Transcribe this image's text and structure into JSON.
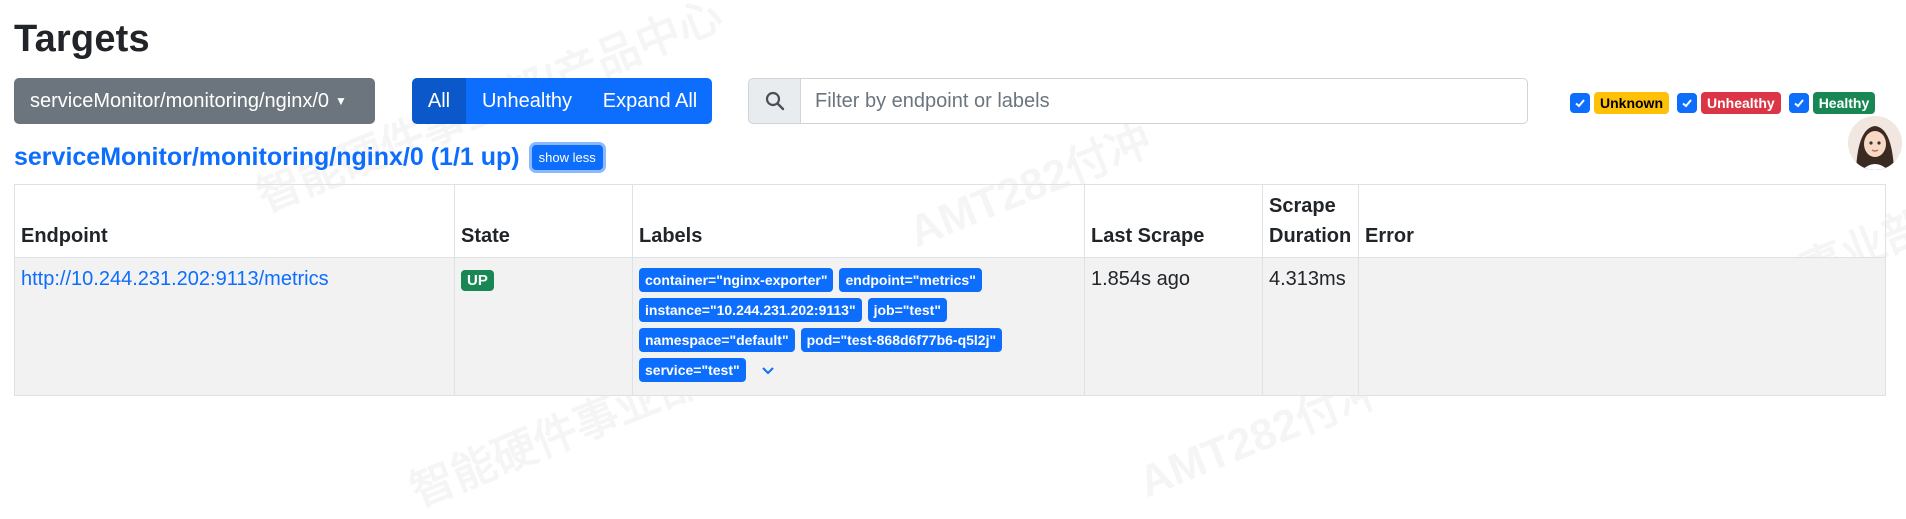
{
  "page": {
    "title": "Targets"
  },
  "controls": {
    "scrape_pool_selected": "serviceMonitor/monitoring/nginx/0",
    "filter_buttons": [
      "All",
      "Unhealthy",
      "Expand All"
    ],
    "active_filter": "All",
    "search": {
      "placeholder": "Filter by endpoint or labels",
      "value": ""
    },
    "health_filters": [
      {
        "label": "Unknown",
        "checked": true,
        "color": "#ffc107"
      },
      {
        "label": "Unhealthy",
        "checked": true,
        "color": "#dc3545"
      },
      {
        "label": "Healthy",
        "checked": true,
        "color": "#198754"
      }
    ]
  },
  "pool": {
    "title": "serviceMonitor/monitoring/nginx/0 (1/1 up)",
    "toggle_label": "show less",
    "columns": [
      "Endpoint",
      "State",
      "Labels",
      "Last Scrape",
      "Scrape Duration",
      "Error"
    ],
    "rows": [
      {
        "endpoint": "http://10.244.231.202:9113/metrics",
        "state": "UP",
        "labels": [
          "container=\"nginx-exporter\"",
          "endpoint=\"metrics\"",
          "instance=\"10.244.231.202:9113\"",
          "job=\"test\"",
          "namespace=\"default\"",
          "pod=\"test-868d6f77b6-q5l2j\"",
          "service=\"test\""
        ],
        "last_scrape": "1.854s ago",
        "scrape_duration": "4.313ms",
        "error": ""
      }
    ]
  },
  "colors": {
    "primary": "#0d6efd",
    "secondary": "#6c757d",
    "success": "#198754"
  },
  "icons": {
    "search": "search-icon",
    "caret": "caret-down-icon",
    "check": "check-icon",
    "expand": "chevron-down-icon"
  }
}
